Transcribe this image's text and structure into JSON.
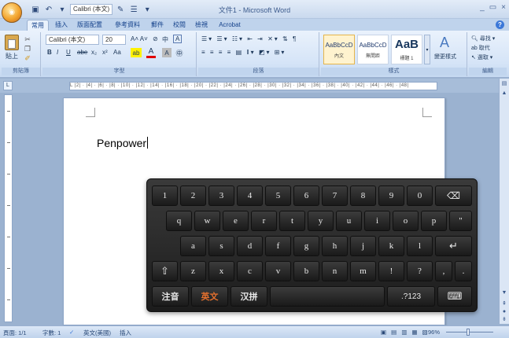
{
  "window": {
    "title": "文件1 - Microsoft Word",
    "controls": [
      "_",
      "▭",
      "×"
    ]
  },
  "qat": {
    "font_name": "Calibri (本文)"
  },
  "tabs": [
    "常用",
    "插入",
    "版面配置",
    "參考資料",
    "郵件",
    "校閱",
    "檢視",
    "Acrobat"
  ],
  "ribbon": {
    "clipboard": {
      "label": "剪貼簿",
      "paste_label": "貼上"
    },
    "font": {
      "label": "字型",
      "font_name": "Calibri (本文)",
      "font_size": "20",
      "format_buttons": [
        "B",
        "I",
        "U",
        "abe",
        "x₂",
        "x²",
        "Aa"
      ]
    },
    "paragraph": {
      "label": "段落"
    },
    "styles": {
      "label": "樣式",
      "items": [
        {
          "sample": "AaBbCcD",
          "name": "內文"
        },
        {
          "sample": "AaBbCcD",
          "name": "無間距"
        },
        {
          "sample": "AaB",
          "name": "標題 1"
        }
      ],
      "change_styles": "變更樣式"
    },
    "editing": {
      "label": "編輯",
      "find": "尋找",
      "replace": "取代",
      "select": "選取"
    }
  },
  "ruler": {
    "text": "L |2| · |4| · |6| · |8| · |10| · |12| · |14| · |16| · |18| · |20| · |22| · |24| · |26| · |28| · |30| · |32| · |34| · |36| · |38| · |40| · |42| · |44| · |46| · |48|"
  },
  "document": {
    "text": "Penpower"
  },
  "status": {
    "page": "頁面: 1/1",
    "words": "字數: 1",
    "language": "英文(美國)",
    "mode": "插入",
    "zoom": "96%"
  },
  "keyboard": {
    "row1": [
      "1",
      "2",
      "3",
      "4",
      "5",
      "6",
      "7",
      "8",
      "9",
      "0",
      "⌫"
    ],
    "row2": [
      {
        "k": "q",
        "h": ""
      },
      {
        "k": "w",
        "h": ""
      },
      {
        "k": "e",
        "h": ""
      },
      {
        "k": "r",
        "h": ""
      },
      {
        "k": "t",
        "h": ""
      },
      {
        "k": "y",
        "h": ""
      },
      {
        "k": "u",
        "h": ""
      },
      {
        "k": "i",
        "h": ""
      },
      {
        "k": "o",
        "h": ""
      },
      {
        "k": "p",
        "h": ""
      },
      {
        "k": "\"",
        "h": ""
      }
    ],
    "row3": [
      "a",
      "s",
      "d",
      "f",
      "g",
      "h",
      "j",
      "k",
      "l",
      "↵"
    ],
    "row4": [
      "⇧",
      "z",
      "x",
      "c",
      "v",
      "b",
      "n",
      "m",
      "!",
      "?",
      ",",
      "."
    ],
    "row5": {
      "zhuyin": "注音",
      "english": "英文",
      "pinyin": "汉拼",
      "space": "",
      "numsym": ".?123",
      "kbd": "⌨"
    }
  },
  "colors": {
    "ribbon_blue": "#c6d9f1",
    "keyboard_bg": "#1c1c1c",
    "active_lang": "#e4702e"
  }
}
